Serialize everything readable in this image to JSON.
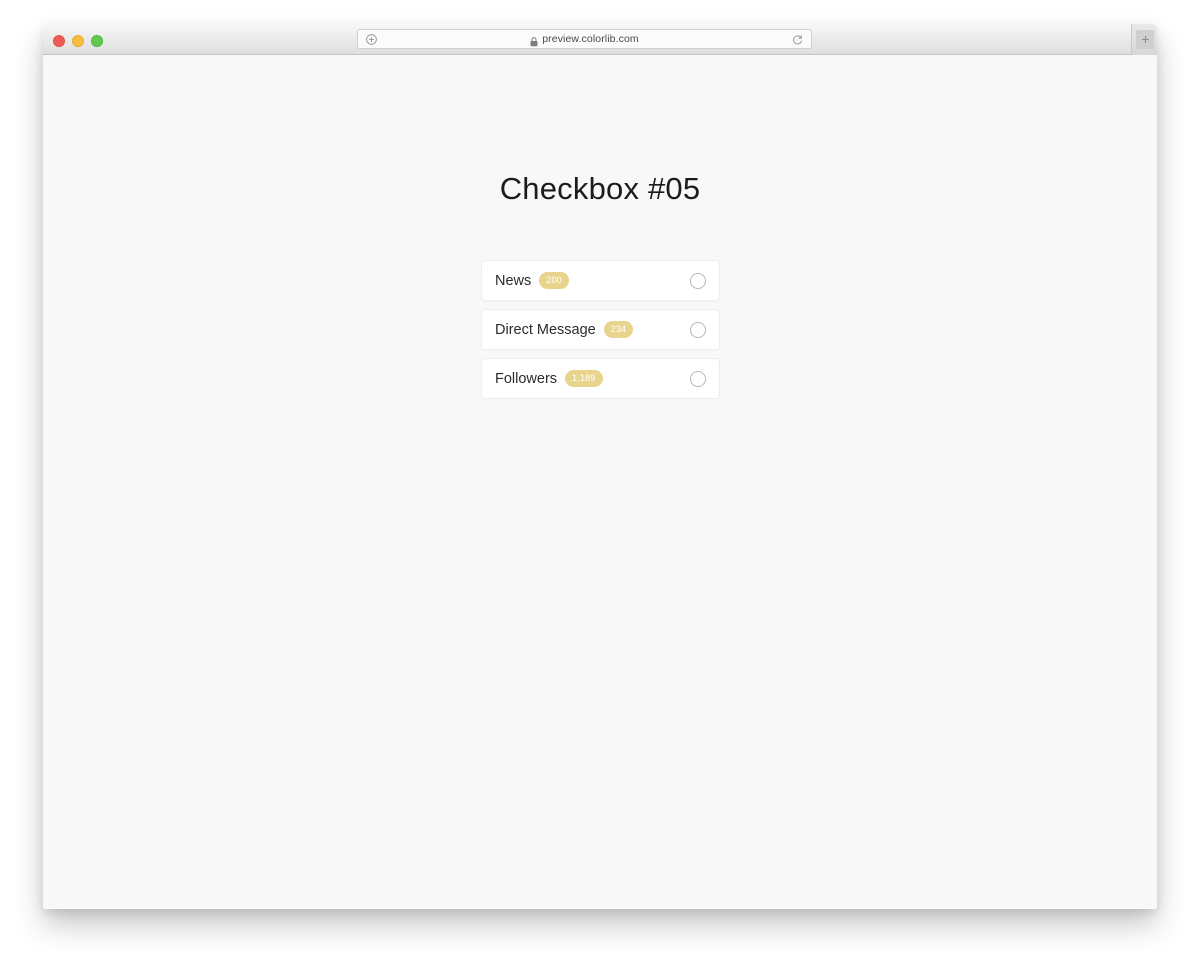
{
  "browser": {
    "traffic_lights": [
      {
        "name": "close",
        "color": "#f05b56"
      },
      {
        "name": "minimize",
        "color": "#f6bd3f"
      },
      {
        "name": "maximize",
        "color": "#5ec84f"
      }
    ],
    "address_bar": {
      "url": "preview.colorlib.com",
      "lock_icon": "lock-icon",
      "left_icon": "compass-icon",
      "reload_icon": "reload-icon"
    },
    "new_tab_label": "+"
  },
  "page": {
    "title": "Checkbox #05",
    "background_color": "#f8f8f8",
    "badge_color": "#e9d48d",
    "items": [
      {
        "label": "News",
        "badge": "200",
        "checked": false
      },
      {
        "label": "Direct Message",
        "badge": "234",
        "checked": false
      },
      {
        "label": "Followers",
        "badge": "1,189",
        "checked": false
      }
    ]
  }
}
